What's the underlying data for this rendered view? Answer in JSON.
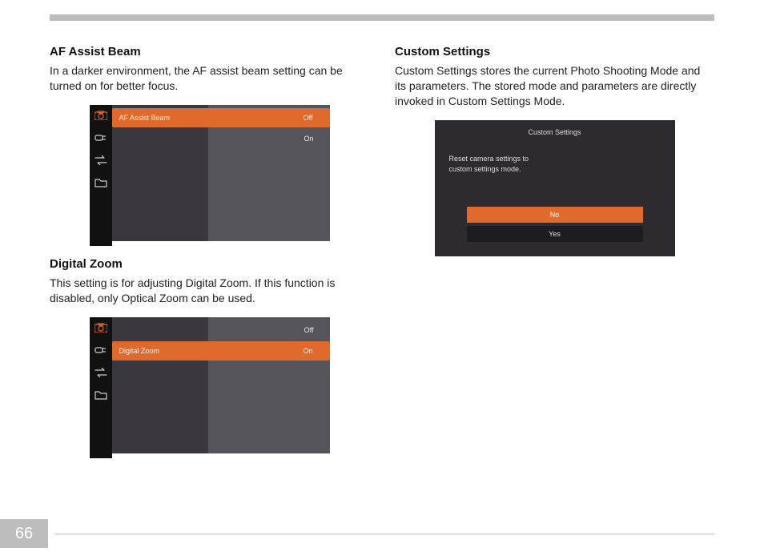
{
  "page_number": "66",
  "left": {
    "section1": {
      "heading": "AF Assist Beam",
      "body": "In a darker environment, the AF assist beam setting can be turned on for better focus.",
      "screenshot": {
        "row_label": "AF Assist Beam",
        "opt_off": "Off",
        "opt_on": "On"
      }
    },
    "section2": {
      "heading": "Digital Zoom",
      "body": "This setting is for adjusting Digital Zoom. If this function is disabled, only Optical Zoom can be used.",
      "screenshot": {
        "row_label": "Digital Zoom",
        "opt_off": "Off",
        "opt_on": "On"
      }
    }
  },
  "right": {
    "section1": {
      "heading": "Custom Settings",
      "body": "Custom Settings stores the current Photo Shooting Mode and its parameters. The stored mode and parameters are directly invoked in Custom Settings Mode.",
      "screenshot": {
        "title": "Custom Settings",
        "message_l1": "Reset camera settings to",
        "message_l2": "custom settings mode.",
        "no": "No",
        "yes": "Yes"
      }
    }
  }
}
